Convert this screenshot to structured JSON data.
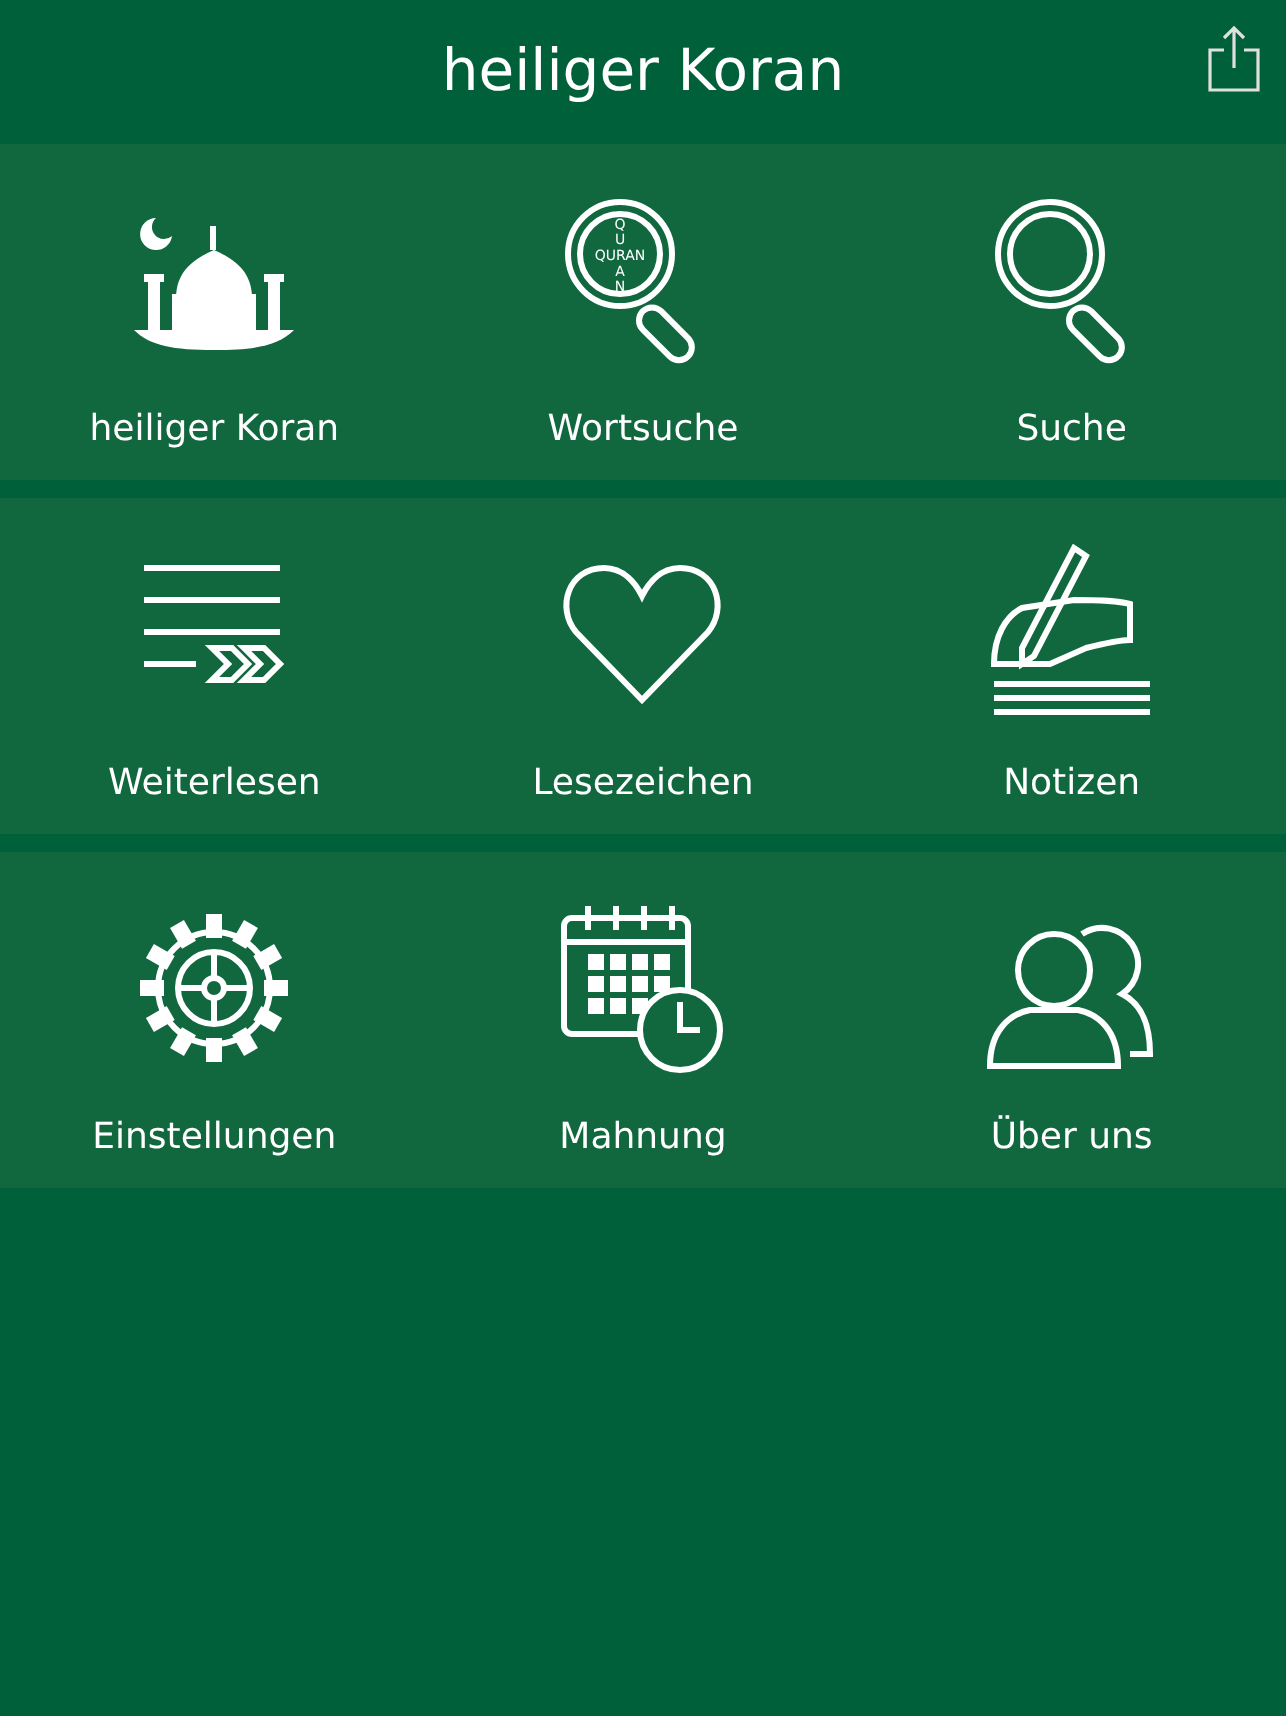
{
  "header": {
    "title": "heiliger Koran"
  },
  "rows": [
    {
      "items": [
        {
          "kind": "mosque",
          "label": "heiliger Koran"
        },
        {
          "kind": "quran-search",
          "label": "Wortsuche",
          "icon_text_above": "QU",
          "icon_text": "QURAN",
          "icon_text_below": "AN"
        },
        {
          "kind": "search",
          "label": "Suche"
        }
      ]
    },
    {
      "items": [
        {
          "kind": "continue",
          "label": "Weiterlesen"
        },
        {
          "kind": "heart",
          "label": "Lesezeichen"
        },
        {
          "kind": "notes",
          "label": "Notizen"
        }
      ]
    },
    {
      "items": [
        {
          "kind": "gear",
          "label": "Einstellungen"
        },
        {
          "kind": "calendar",
          "label": "Mahnung"
        },
        {
          "kind": "people",
          "label": "Über uns"
        }
      ]
    }
  ]
}
